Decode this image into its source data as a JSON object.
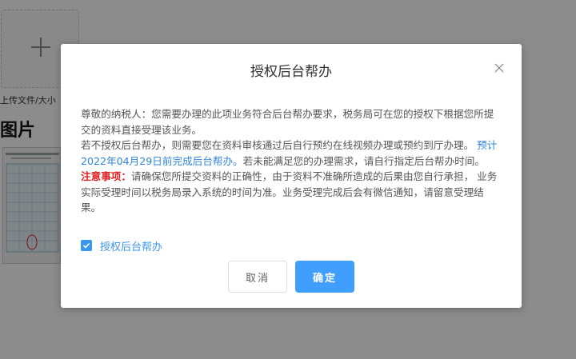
{
  "background": {
    "upload_caption": "上传文件/大小",
    "section_title": "图片"
  },
  "dialog": {
    "title": "授权后台帮办",
    "body": {
      "para1": "尊敬的纳税人：您需要办理的此项业务符合后台帮办要求，税务局可在您的授权下根据您所提交的资料直接受理该业务。",
      "para2_prefix": "若不授权后台帮办，则需要您在资料审核通过后自行预约在线视频办理或预约到厅办理。",
      "para2_date": "预计2022年04月29日前完成后台帮办。",
      "para2_suffix": "若未能满足您的办理需求，请自行指定后台帮办时间。",
      "notice_label": "注意事项：",
      "notice_text": "请确保您所提交资料的正确性，由于资料不准确所造成的后果由您自行承担， 业务实际受理时间以税务局录入系统的时间为准。业务受理完成后会有微信通知，请留意受理结果。"
    },
    "checkbox": {
      "label": "授权后台帮办",
      "checked": true
    },
    "cancel_label": "取消",
    "confirm_label": "确定"
  },
  "colors": {
    "accent": "#409eff",
    "link": "#2f84d8",
    "notice": "#e02020"
  },
  "icons": {
    "close": "close-icon",
    "check": "check-icon",
    "plus": "plus-icon"
  }
}
